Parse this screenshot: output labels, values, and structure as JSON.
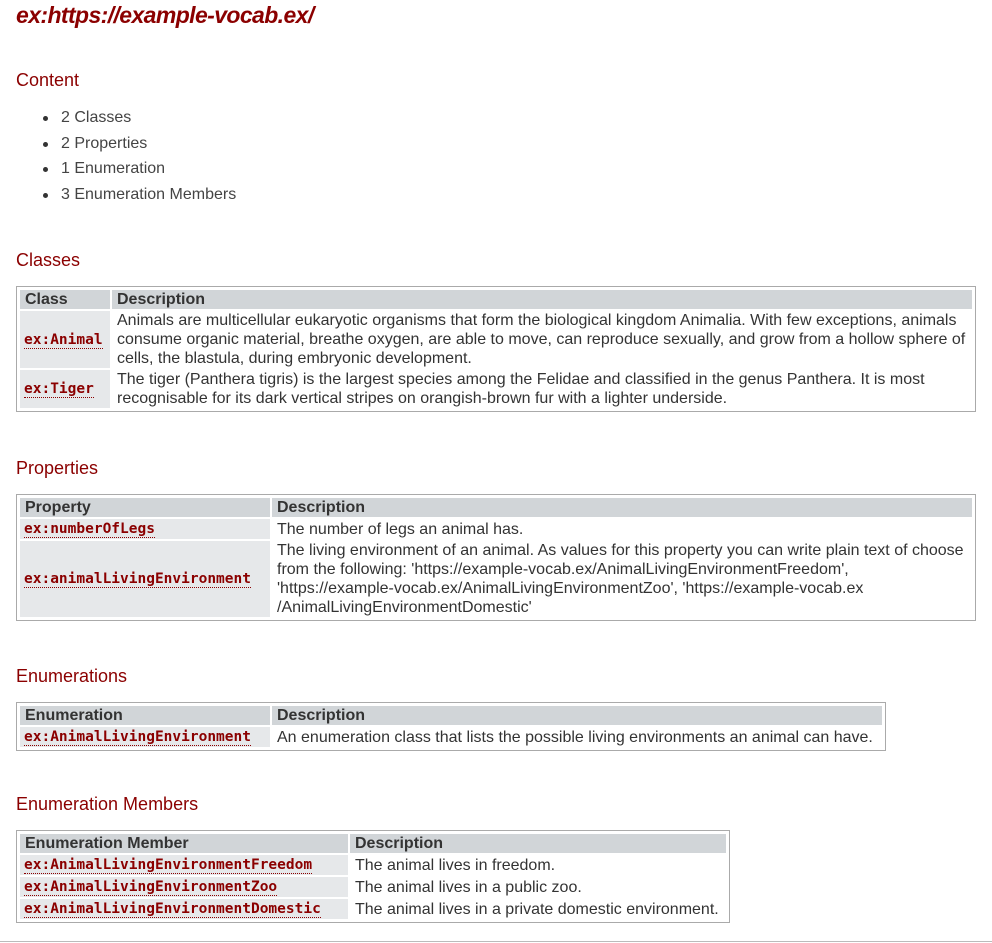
{
  "title": "ex:https://example-vocab.ex/",
  "sections": {
    "content": "Content",
    "classes": "Classes",
    "properties": "Properties",
    "enumerations": "Enumerations",
    "members": "Enumeration Members"
  },
  "content_items": [
    "2 Classes",
    "2 Properties",
    "1 Enumeration",
    "3 Enumeration Members"
  ],
  "classes": {
    "headers": [
      "Class",
      "Description"
    ],
    "rows": [
      {
        "term": "ex:Animal",
        "desc": "Animals are multicellular eukaryotic organisms that form the biological kingdom Animalia. With few exceptions, animals consume organic material, breathe oxygen, are able to move, can reproduce sexually, and grow from a hollow sphere of cells, the blastula, during embryonic development."
      },
      {
        "term": "ex:Tiger",
        "desc": "The tiger (Panthera tigris) is the largest species among the Felidae and classified in the genus Panthera. It is most recognisable for its dark vertical stripes on orangish-brown fur with a lighter underside."
      }
    ]
  },
  "properties": {
    "headers": [
      "Property",
      "Description"
    ],
    "rows": [
      {
        "term": "ex:numberOfLegs",
        "desc": "The number of legs an animal has."
      },
      {
        "term": "ex:animalLivingEnvironment",
        "desc": "The living environment of an animal. As values for this property you can write plain text of choose from the following: 'https://example-vocab.ex/AnimalLivingEnvironmentFreedom', 'https://example-vocab.ex/AnimalLivingEnvironmentZoo', 'https://example-vocab.ex /AnimalLivingEnvironmentDomestic'"
      }
    ]
  },
  "enumerations": {
    "headers": [
      "Enumeration",
      "Description"
    ],
    "rows": [
      {
        "term": "ex:AnimalLivingEnvironment",
        "desc": "An enumeration class that lists the possible living environments an animal can have."
      }
    ]
  },
  "members": {
    "headers": [
      "Enumeration Member",
      "Description"
    ],
    "rows": [
      {
        "term": "ex:AnimalLivingEnvironmentFreedom",
        "desc": "The animal lives in freedom."
      },
      {
        "term": "ex:AnimalLivingEnvironmentZoo",
        "desc": "The animal lives in a public zoo."
      },
      {
        "term": "ex:AnimalLivingEnvironmentDomestic",
        "desc": "The animal lives in a private domestic environment."
      }
    ]
  }
}
